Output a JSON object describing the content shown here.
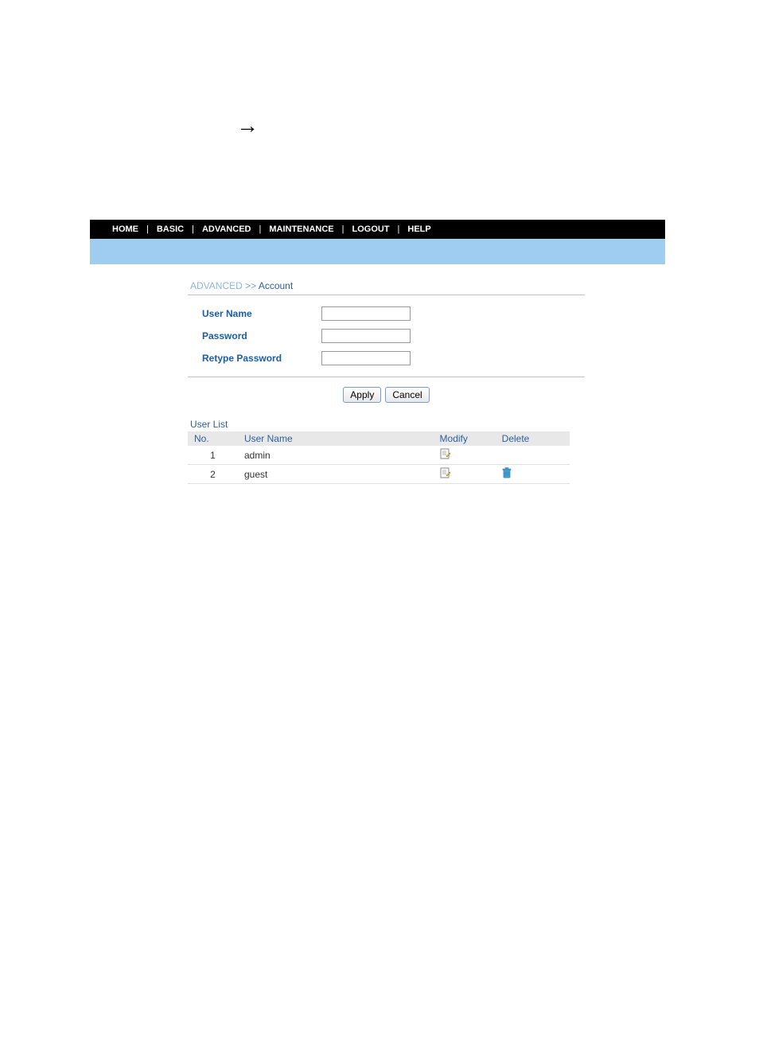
{
  "nav": {
    "items": [
      "HOME",
      "BASIC",
      "ADVANCED",
      "MAINTENANCE",
      "LOGOUT",
      "HELP"
    ]
  },
  "breadcrumb": {
    "parent": "ADVANCED",
    "separator": ">>",
    "current": "Account"
  },
  "form": {
    "username_label": "User Name",
    "password_label": "Password",
    "retype_password_label": "Retype Password",
    "username_value": "",
    "password_value": "",
    "retype_password_value": ""
  },
  "buttons": {
    "apply": "Apply",
    "cancel": "Cancel"
  },
  "userlist": {
    "title": "User List",
    "headers": {
      "no": "No.",
      "username": "User Name",
      "modify": "Modify",
      "delete": "Delete"
    },
    "rows": [
      {
        "no": "1",
        "username": "admin",
        "can_delete": false
      },
      {
        "no": "2",
        "username": "guest",
        "can_delete": true
      }
    ]
  }
}
